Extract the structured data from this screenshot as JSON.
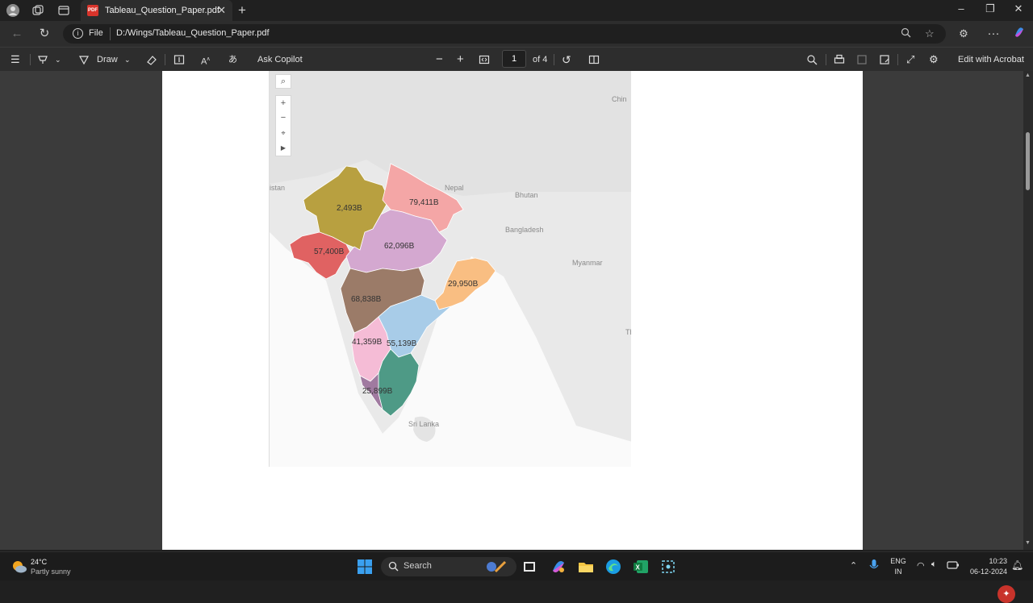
{
  "browser": {
    "tab_title": "Tableau_Question_Paper.pdf",
    "address_label": "File",
    "url": "D:/Wings/Tableau_Question_Paper.pdf"
  },
  "pdf_toolbar": {
    "draw_label": "Draw",
    "ask_copilot_label": "Ask Copilot",
    "current_page": "1",
    "page_count_label": "of 4",
    "edit_acrobat_label": "Edit with Acrobat"
  },
  "map": {
    "place_labels": {
      "pakistan": "istan",
      "nepal": "Nepal",
      "bhutan": "Bhutan",
      "bangladesh": "Bangladesh",
      "myanmar": "Myanmar",
      "china": "Chin",
      "sri_lanka": "Sri Lanka",
      "thailand": "Th"
    },
    "regions": [
      {
        "name": "rajasthan",
        "value_label": "2,493B",
        "color": "#b8a040"
      },
      {
        "name": "uttar-pradesh",
        "value_label": "79,411B",
        "color": "#f4a6a6"
      },
      {
        "name": "gujarat",
        "value_label": "57,400B",
        "color": "#e06262"
      },
      {
        "name": "madhya-pradesh",
        "value_label": "62,096B",
        "color": "#d4a8d0"
      },
      {
        "name": "odisha",
        "value_label": "29,950B",
        "color": "#f9be82"
      },
      {
        "name": "maharashtra",
        "value_label": "68,838B",
        "color": "#9b7b68"
      },
      {
        "name": "karnataka",
        "value_label": "41,359B",
        "color": "#f5bcd6"
      },
      {
        "name": "andhra-pradesh",
        "value_label": "55,139B",
        "color": "#a8cce8"
      },
      {
        "name": "tamil-nadu",
        "value_label": "25,899B",
        "color": "#4e9a86"
      },
      {
        "name": "kerala",
        "value_label": "",
        "color": "#a07aa0"
      }
    ]
  },
  "taskbar": {
    "weather_temp": "24°C",
    "weather_desc": "Partly sunny",
    "search_placeholder": "Search",
    "lang_top": "ENG",
    "lang_bottom": "IN",
    "time": "10:23",
    "date": "06-12-2024"
  }
}
